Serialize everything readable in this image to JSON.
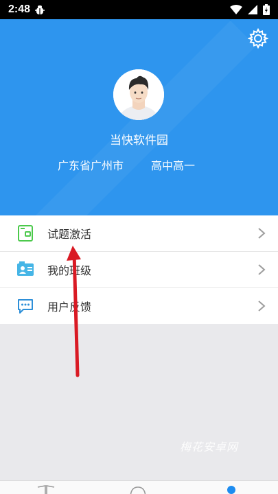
{
  "status_bar": {
    "time": "2:48"
  },
  "header": {
    "username": "当快软件园",
    "region": "广东省广州市",
    "grade": "高中高一",
    "accent": "#2390ee"
  },
  "menu": {
    "items": [
      {
        "label": "试题激活",
        "icon": "activation-card-icon",
        "icon_color": "#4cc94c"
      },
      {
        "label": "我的班级",
        "icon": "class-id-card-icon",
        "icon_color": "#45b5e6"
      },
      {
        "label": "用户反馈",
        "icon": "feedback-chat-icon",
        "icon_color": "#2d8fd8"
      }
    ]
  },
  "watermark": "梅花安卓网",
  "bottom_nav": {
    "active_dot_color": "#1d8cf0"
  }
}
